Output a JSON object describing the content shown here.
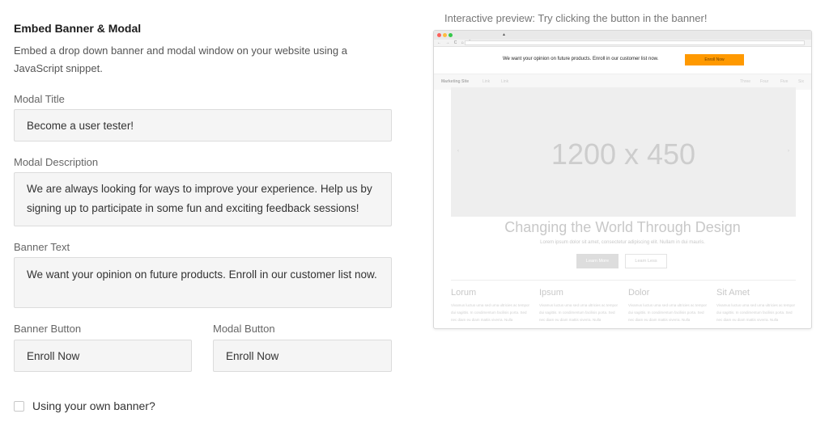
{
  "form": {
    "heading": "Embed Banner & Modal",
    "description": "Embed a drop down banner and modal window on your website using a JavaScript snippet.",
    "modal_title_label": "Modal Title",
    "modal_title_value": "Become a user tester!",
    "modal_description_label": "Modal Description",
    "modal_description_value": "We are always looking for ways to improve your experience. Help us by signing up to participate in some fun and exciting feedback sessions!",
    "banner_text_label": "Banner Text",
    "banner_text_value": "We want your opinion on future products. Enroll in our customer list now.",
    "banner_button_label": "Banner Button",
    "banner_button_value": "Enroll Now",
    "modal_button_label": "Modal Button",
    "modal_button_value": "Enroll Now",
    "own_banner_label": "Using your own banner?"
  },
  "preview": {
    "caption": "Interactive preview: Try clicking the button in the banner!",
    "tab_indicator": "▲",
    "nav_icons": "← → C ⌂ 🔍",
    "banner_text": "We want your opinion on future products. Enroll in our customer list now.",
    "banner_button": "Enroll Now",
    "site_brand": "Marketing Site",
    "nav_left": [
      "Link",
      "Link"
    ],
    "nav_right": [
      "Three",
      "Four",
      "Five",
      "Six"
    ],
    "hero_placeholder": "1200 x 450",
    "arrow_left": "‹",
    "arrow_right": "›",
    "site_title": "Changing the World Through Design",
    "site_subtitle": "Lorem ipsum dolor sit amet, consectetur adipiscing elit. Nullam in dui mauris.",
    "learn_more": "Learn More",
    "learn_less": "Learn Less",
    "columns": [
      {
        "title": "Lorum",
        "body": "Vivamus luctus urna sed urna ultricies ac tempor dui sagittis. In condimentum facilisis porta. Sed nec diam eu diam mattis viverra. Nulla"
      },
      {
        "title": "Ipsum",
        "body": "Vivamus luctus urna sed urna ultricies ac tempor dui sagittis. In condimentum facilisis porta. Sed nec diam eu diam mattis viverra. Nulla"
      },
      {
        "title": "Dolor",
        "body": "Vivamus luctus urna sed urna ultricies ac tempor dui sagittis. In condimentum facilisis porta. Sed nec diam eu diam mattis viverra. Nulla"
      },
      {
        "title": "Sit Amet",
        "body": "Vivamus luctus urna sed urna ultricies ac tempor dui sagittis. In condimentum facilisis porta. Sed nec diam eu diam mattis viverra. Nulla"
      }
    ]
  },
  "colors": {
    "banner_button": "#ff9900",
    "traffic_red": "#fc605b",
    "traffic_yellow": "#fdbc40",
    "traffic_green": "#34c84a"
  }
}
